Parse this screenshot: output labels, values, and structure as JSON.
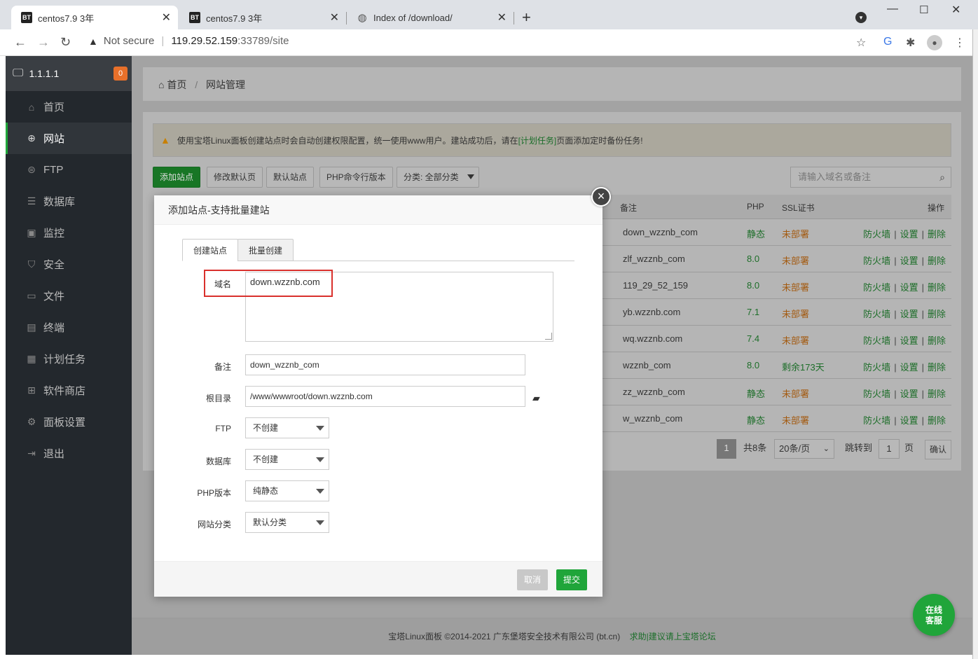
{
  "browser": {
    "tabs": [
      {
        "title": "centos7.9 3年",
        "favicon": "BT"
      },
      {
        "title": "centos7.9 3年",
        "favicon": "BT"
      },
      {
        "title": "Index of /download/",
        "favicon": "globe-icon"
      }
    ],
    "new_tab": "+",
    "address": {
      "warning": "Not secure",
      "host": "119.29.52.159",
      "port_path": ":33789/site"
    }
  },
  "sidebar": {
    "server_label": "1.1.1.1",
    "badge_count": "0",
    "items": [
      {
        "label": "首页",
        "icon": "home-icon"
      },
      {
        "label": "网站",
        "icon": "globe-icon",
        "active": true
      },
      {
        "label": "FTP",
        "icon": "ftp-icon"
      },
      {
        "label": "数据库",
        "icon": "database-icon"
      },
      {
        "label": "监控",
        "icon": "monitor-icon"
      },
      {
        "label": "安全",
        "icon": "shield-icon"
      },
      {
        "label": "文件",
        "icon": "folder-icon"
      },
      {
        "label": "终端",
        "icon": "terminal-icon"
      },
      {
        "label": "计划任务",
        "icon": "calendar-icon"
      },
      {
        "label": "软件商店",
        "icon": "grid-icon"
      },
      {
        "label": "面板设置",
        "icon": "gear-icon"
      },
      {
        "label": "退出",
        "icon": "logout-icon"
      }
    ]
  },
  "breadcrumb": {
    "home": "首页",
    "sep": "/",
    "current": "网站管理"
  },
  "alert": {
    "text_before": "使用宝塔Linux面板创建站点时会自动创建权限配置，统一使用www用户。建站成功后，请在",
    "link": "[计划任务]",
    "text_after": "页面添加定时备份任务!"
  },
  "toolbar": {
    "add_site": "添加站点",
    "edit_default_page": "修改默认页",
    "default_site": "默认站点",
    "php_cli": "PHP命令行版本",
    "category": "分类: 全部分类",
    "search_placeholder": "请输入域名或备注"
  },
  "table": {
    "headers": {
      "remark": "备注",
      "php": "PHP",
      "ssl": "SSL证书",
      "ops": "操作"
    },
    "ops": {
      "firewall": "防火墙",
      "settings": "设置",
      "delete": "删除",
      "sep": "|"
    },
    "rows": [
      {
        "remark": "down_wzznb_com",
        "php": "静态",
        "ssl": "未部署",
        "ssl_ok": false
      },
      {
        "remark": "zlf_wzznb_com",
        "php": "8.0",
        "ssl": "未部署",
        "ssl_ok": false
      },
      {
        "remark": "119_29_52_159",
        "php": "8.0",
        "ssl": "未部署",
        "ssl_ok": false
      },
      {
        "remark": "yb.wzznb.com",
        "php": "7.1",
        "ssl": "未部署",
        "ssl_ok": false
      },
      {
        "remark": "wq.wzznb.com",
        "php": "7.4",
        "ssl": "未部署",
        "ssl_ok": false
      },
      {
        "remark": "wzznb_com",
        "php": "8.0",
        "ssl": "剩余173天",
        "ssl_ok": true
      },
      {
        "remark": "zz_wzznb_com",
        "php": "静态",
        "ssl": "未部署",
        "ssl_ok": false
      },
      {
        "remark": "w_wzznb_com",
        "php": "静态",
        "ssl": "未部署",
        "ssl_ok": false
      }
    ]
  },
  "pager": {
    "current": "1",
    "total": "共8条",
    "per_page": "20条/页",
    "jump_label": "跳转到",
    "jump_value": "1",
    "page_unit": "页",
    "confirm": "确认"
  },
  "footer": {
    "copyright": "宝塔Linux面板 ©2014-2021 广东堡塔安全技术有限公司 (bt.cn)",
    "link": "求助|建议请上宝塔论坛"
  },
  "online_service": {
    "line1": "在线",
    "line2": "客服"
  },
  "modal": {
    "title": "添加站点-支持批量建站",
    "close": "×",
    "tabs": [
      "创建站点",
      "批量创建"
    ],
    "fields": {
      "domain_label": "域名",
      "domain_value": "down.wzznb.com",
      "remark_label": "备注",
      "remark_value": "down_wzznb_com",
      "root_label": "根目录",
      "root_value": "/www/wwwroot/down.wzznb.com",
      "ftp_label": "FTP",
      "ftp_value": "不创建",
      "db_label": "数据库",
      "db_value": "不创建",
      "php_label": "PHP版本",
      "php_value": "纯静态",
      "category_label": "网站分类",
      "category_value": "默认分类"
    },
    "cancel": "取消",
    "submit": "提交"
  },
  "colors": {
    "accent": "#20a53a",
    "sidebar_bg": "#23282d",
    "highlight_border": "#d9302c"
  }
}
